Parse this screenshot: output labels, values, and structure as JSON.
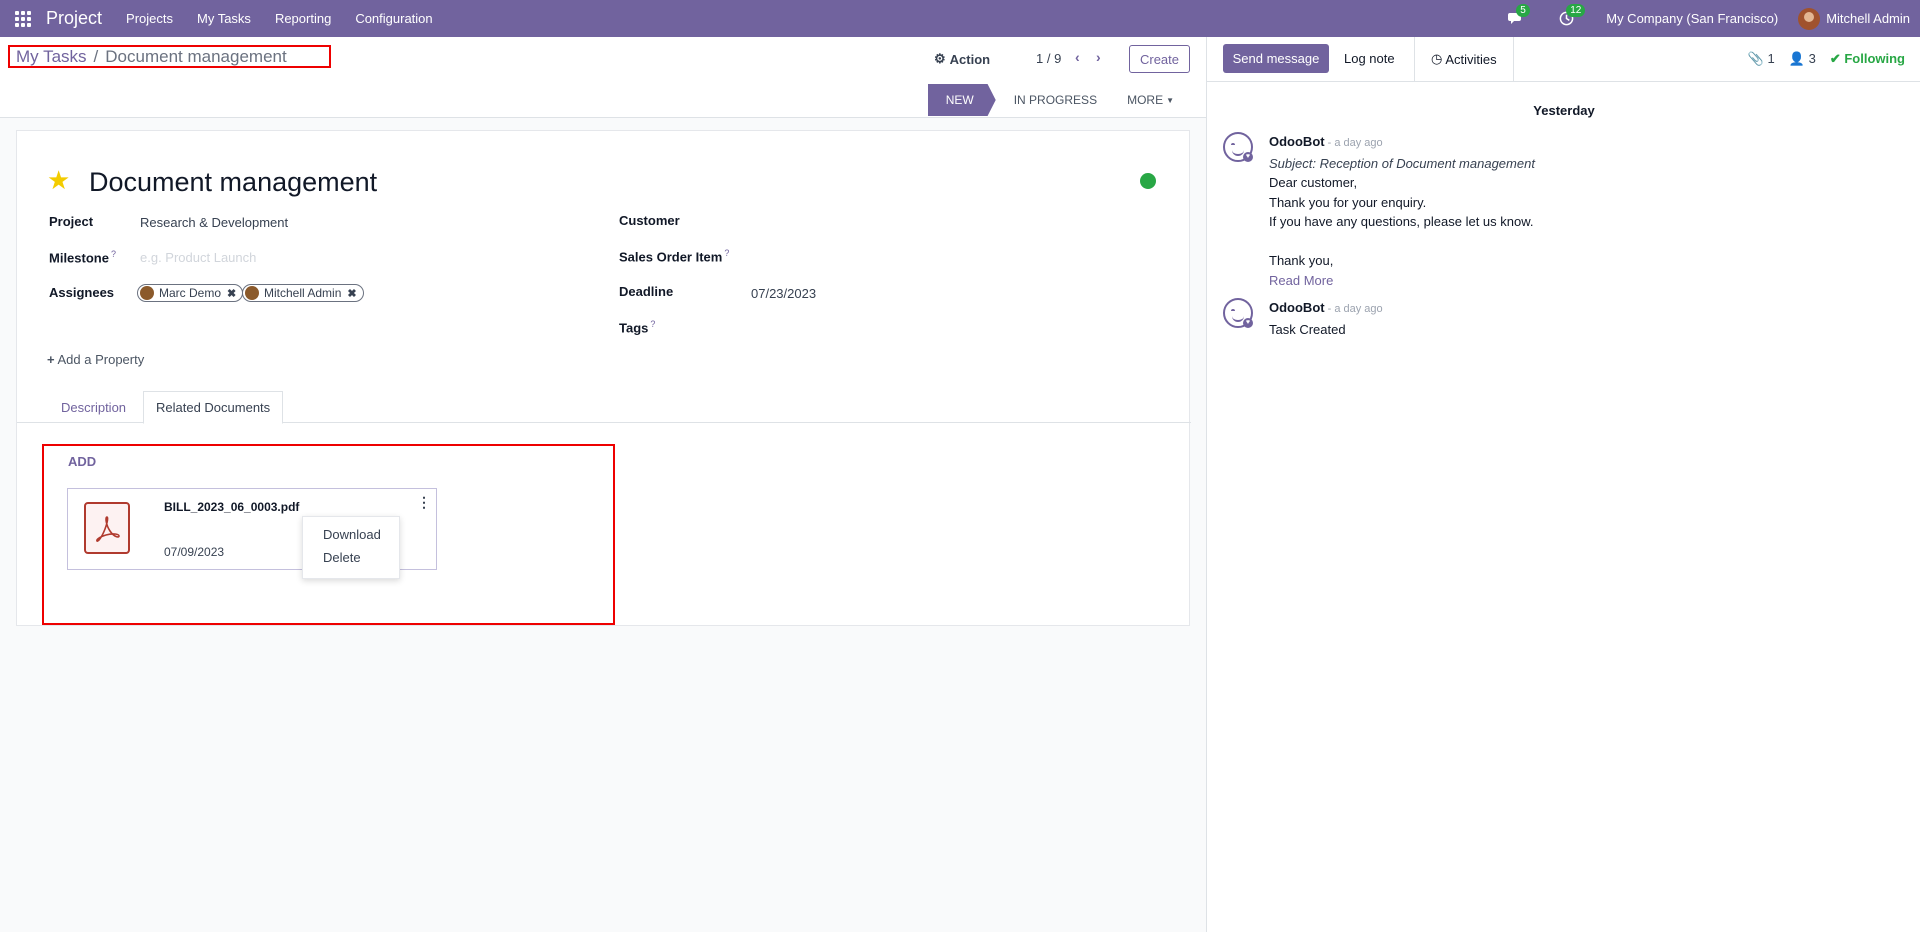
{
  "navbar": {
    "brand": "Project",
    "menu": [
      "Projects",
      "My Tasks",
      "Reporting",
      "Configuration"
    ],
    "messages_count": "5",
    "activities_count": "12",
    "company": "My Company (San Francisco)",
    "user": "Mitchell Admin"
  },
  "breadcrumb": {
    "parent": "My Tasks",
    "separator": "/",
    "current": "Document management"
  },
  "control": {
    "action_label": "Action",
    "pager": "1 / 9",
    "create_label": "Create"
  },
  "statusbar": {
    "stages": [
      "NEW",
      "IN PROGRESS"
    ],
    "more_label": "MORE"
  },
  "form": {
    "title": "Document management",
    "fields": {
      "project_label": "Project",
      "project_value": "Research & Development",
      "milestone_label": "Milestone",
      "milestone_placeholder": "e.g. Product Launch",
      "assignees_label": "Assignees",
      "assignees": [
        "Marc Demo",
        "Mitchell Admin"
      ],
      "customer_label": "Customer",
      "sales_order_label": "Sales Order Item",
      "deadline_label": "Deadline",
      "deadline_value": "07/23/2023",
      "tags_label": "Tags",
      "help_mark": "?"
    },
    "add_property": "Add a Property",
    "tabs": [
      "Description",
      "Related Documents"
    ],
    "documents": {
      "add_label": "ADD",
      "items": [
        {
          "name": "BILL_2023_06_0003.pdf",
          "date": "07/09/2023"
        }
      ],
      "menu": [
        "Download",
        "Delete"
      ]
    }
  },
  "chatter": {
    "send_message": "Send message",
    "log_note": "Log note",
    "activities": "Activities",
    "attachments_count": "1",
    "followers_count": "3",
    "following": "Following",
    "day_separator": "Yesterday",
    "messages": [
      {
        "author": "OdooBot",
        "time": "- a day ago",
        "subject": "Subject: Reception of Document management",
        "lines": [
          "Dear customer,",
          "Thank you for your enquiry.",
          "If you have any questions, please let us know.",
          "",
          "Thank you,"
        ],
        "read_more": "Read More"
      },
      {
        "author": "OdooBot",
        "time": "- a day ago",
        "text": "Task Created"
      }
    ]
  },
  "colors": {
    "brand": "#71639e",
    "success": "#28a745",
    "highlight_border": "#e00000"
  }
}
